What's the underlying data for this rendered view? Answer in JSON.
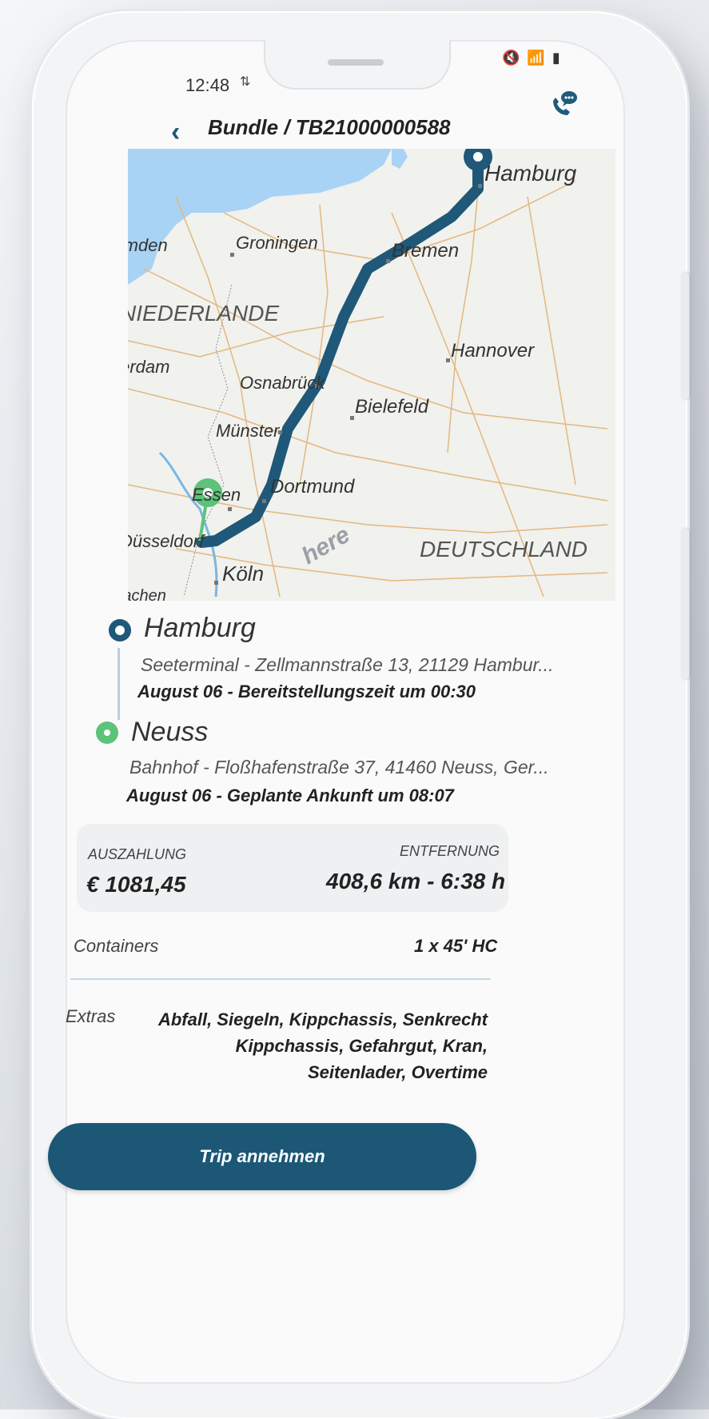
{
  "status": {
    "time": "12:48",
    "arrows": "⇅",
    "icons": "🔇 📶 ▮"
  },
  "header": {
    "back_icon": "‹",
    "title": "Bundle / TB21000000588"
  },
  "map": {
    "labels": [
      "Hamburg",
      "Groningen",
      "Bremen",
      "NIEDERLANDE",
      "Amsterdam",
      "Hannover",
      "Osnabrück",
      "Bielefeld",
      "Münster",
      "Dortmund",
      "Essen",
      "Düsseldorf",
      "Köln",
      "DEUTSCHLAND",
      "Emden",
      "Aachen"
    ],
    "watermark": "here"
  },
  "origin": {
    "city": "Hamburg",
    "address": "Seeterminal - Zellmannstraße 13, 21129 Hambur...",
    "time": "August 06 - Bereitstellungszeit um 00:30"
  },
  "destination": {
    "city": "Neuss",
    "address": "Bahnhof - Floßhafenstraße 37, 41460 Neuss, Ger...",
    "time": "August 06 - Geplante Ankunft um 08:07"
  },
  "stats": {
    "payout_label": "AUSZAHLUNG",
    "payout_value": "€ 1081,45",
    "distance_label": "ENTFERNUNG",
    "distance_value": "408,6 km - 6:38 h"
  },
  "containers": {
    "label": "Containers",
    "value": "1 x 45' HC"
  },
  "extras": {
    "label": "Extras",
    "value": "Abfall, Siegeln, Kippchassis, Senkrecht Kippchassis, Gefahrgut, Kran, Seitenlader, Overtime"
  },
  "cta": {
    "label": "Trip annehmen"
  },
  "colors": {
    "primary": "#1c5776",
    "route": "#1f5878",
    "destination_pin": "#5dc27a",
    "water": "#a9d3f5"
  }
}
